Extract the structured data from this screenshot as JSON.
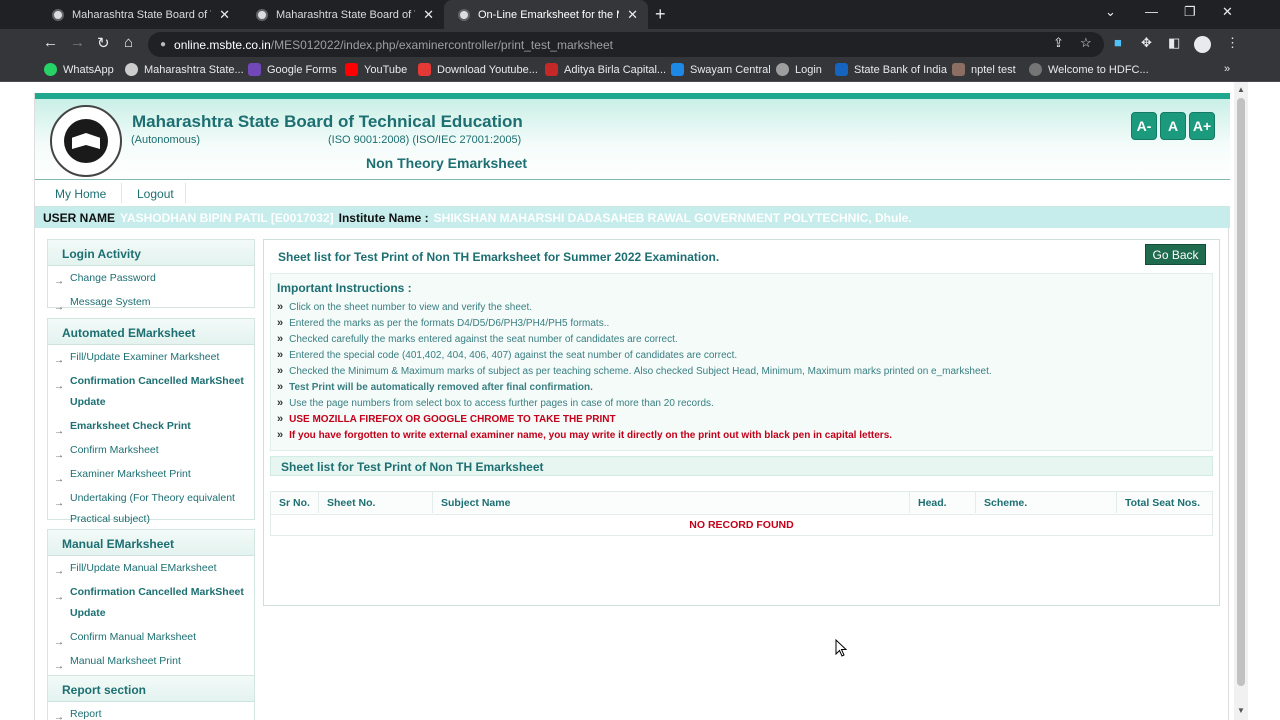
{
  "browser": {
    "tabs": [
      {
        "title": "Maharashtra State Board of Technic",
        "active": false
      },
      {
        "title": "Maharashtra State Board of Technic",
        "active": false
      },
      {
        "title": "On-Line Emarksheet for the MSBTE",
        "active": true
      }
    ],
    "url_host": "online.msbte.co.in",
    "url_path": "/MES012022/index.php/examinercontroller/print_test_marksheet",
    "bookmarks": [
      "WhatsApp",
      "Maharashtra State...",
      "Google Forms",
      "YouTube",
      "Download Youtube...",
      "Aditya Birla Capital...",
      "Swayam Central",
      "Login",
      "State Bank of India",
      "nptel test",
      "Welcome to HDFC..."
    ]
  },
  "header": {
    "org_name": "Maharashtra State Board of Technical Education",
    "autonomous": "(Autonomous)",
    "iso": "(ISO 9001:2008) (ISO/IEC 27001:2005)",
    "page_title": "Non Theory Emarksheet",
    "font_buttons": [
      "A-",
      "A",
      "A+"
    ]
  },
  "nav": {
    "home": "My Home",
    "logout": "Logout"
  },
  "user": {
    "user_label": "USER NAME",
    "user_value": "YASHODHAN BIPIN PATIL [E0017032]",
    "inst_label": "Institute Name :",
    "inst_value": "SHIKSHAN MAHARSHI DADASAHEB RAWAL GOVERNMENT POLYTECHNIC, Dhule."
  },
  "sidebar": {
    "login": {
      "title": "Login Activity",
      "items": [
        "Change Password",
        "Message System"
      ]
    },
    "auto": {
      "title": "Automated EMarksheet",
      "items": [
        "Fill/Update Examiner Marksheet",
        "Confirmation Cancelled MarkSheet Update",
        "Emarksheet Check Print",
        "Confirm Marksheet",
        "Examiner Marksheet Print",
        "Undertaking (For Theory equivalent Practical subject)"
      ]
    },
    "manual": {
      "title": "Manual EMarksheet",
      "items": [
        "Fill/Update Manual EMarksheet",
        "Confirmation Cancelled MarkSheet Update",
        "Confirm Manual Marksheet",
        "Manual Marksheet Print"
      ]
    },
    "report": {
      "title": "Report section",
      "items": [
        "Report"
      ]
    }
  },
  "main": {
    "heading": "Sheet list for Test Print of Non TH Emarksheet for Summer 2022 Examination.",
    "go_back": "Go Back",
    "instructions_title": "Important Instructions :",
    "instructions": [
      "Click on the sheet number to view and verify the sheet.",
      "Entered the marks as per the formats D4/D5/D6/PH3/PH4/PH5 formats..",
      "Checked carefully the marks entered against the seat number of candidates are correct.",
      "Entered the special code (401,402, 404, 406, 407) against the seat number of candidates are correct.",
      "Checked the Minimum & Maximum marks of subject as per teaching scheme. Also checked Subject Head, Minimum, Maximum marks printed on e_marksheet.",
      "Test Print will be automatically removed after final confirmation.",
      "Use the page numbers from select box to access further pages in case of more than 20 records.",
      "USE MOZILLA FIREFOX OR GOOGLE CHROME TO TAKE THE PRINT",
      "If you have forgotten to write external examiner name, you may write it directly on the print out with black pen in capital letters."
    ],
    "sheet_list_title": "Sheet list for Test Print of Non TH Emarksheet",
    "columns": [
      "Sr No.",
      "Sheet No.",
      "Subject Name",
      "Head.",
      "Scheme.",
      "Total Seat Nos."
    ],
    "no_record": "NO RECORD FOUND"
  }
}
